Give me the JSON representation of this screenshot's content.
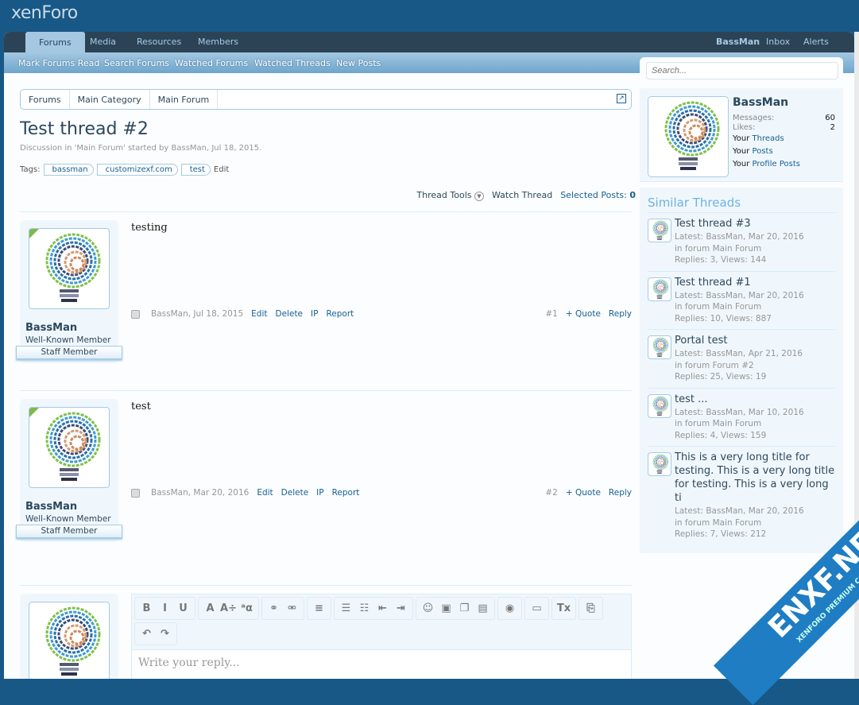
{
  "header": {
    "logo": "xenForo"
  },
  "nav": {
    "tabs": [
      "Forums",
      "Media",
      "Resources",
      "Members"
    ],
    "user": "BassMan",
    "inbox": "Inbox",
    "alerts": "Alerts",
    "subnav": [
      "Mark Forums Read",
      "Search Forums",
      "Watched Forums",
      "Watched Threads",
      "New Posts"
    ]
  },
  "search": {
    "placeholder": "Search..."
  },
  "visitor": {
    "name": "BassMan",
    "messages_label": "Messages:",
    "messages": "60",
    "likes_label": "Likes:",
    "likes": "2",
    "your": "Your",
    "threads": "Threads",
    "posts": "Posts",
    "profile_posts": "Profile Posts"
  },
  "breadcrumb": [
    "Forums",
    "Main Category",
    "Main Forum"
  ],
  "thread": {
    "title": "Test thread #2",
    "description": "Discussion in 'Main Forum' started by BassMan, Jul 18, 2015.",
    "tags_label": "Tags:",
    "tags": [
      "bassman",
      "customizexf.com",
      "test"
    ],
    "tags_edit": "Edit"
  },
  "tools": {
    "thread_tools": "Thread Tools",
    "watch": "Watch Thread",
    "selected_label": "Selected Posts:",
    "selected": "0"
  },
  "posts": [
    {
      "author": "BassMan",
      "title": "Well-Known Member",
      "badge": "Staff Member",
      "message": "testing",
      "date": "BassMan, Jul 18, 2015",
      "edit": "Edit",
      "delete": "Delete",
      "ip": "IP",
      "report": "Report",
      "number": "#1",
      "quote": "+ Quote",
      "reply": "Reply"
    },
    {
      "author": "BassMan",
      "title": "Well-Known Member",
      "badge": "Staff Member",
      "message": "test",
      "date": "BassMan, Mar 20, 2016",
      "edit": "Edit",
      "delete": "Delete",
      "ip": "IP",
      "report": "Report",
      "number": "#2",
      "quote": "+ Quote",
      "reply": "Reply"
    }
  ],
  "editor": {
    "placeholder": "Write your reply...",
    "buttons": [
      "B",
      "I",
      "U",
      "A",
      "A÷",
      "ᵃα",
      "⚭",
      "⚮",
      "≡",
      "☰",
      "☷",
      "⇤",
      "⇥",
      "☺",
      "▣",
      "❐",
      "▤",
      "◉",
      "▭",
      "Tx",
      "⎘",
      "↶",
      "↷"
    ]
  },
  "similar": {
    "title": "Similar Threads",
    "items": [
      {
        "title": "Test thread #3",
        "latest": "Latest: BassMan, Mar 20, 2016",
        "forum": "in forum Main Forum",
        "stats": "Replies: 3, Views: 144"
      },
      {
        "title": "Test thread #1",
        "latest": "Latest: BassMan, Mar 20, 2016",
        "forum": "in forum Main Forum",
        "stats": "Replies: 10, Views: 887"
      },
      {
        "title": "Portal test",
        "latest": "Latest: BassMan, Apr 21, 2016",
        "forum": "in forum Forum #2",
        "stats": "Replies: 25, Views: 19"
      },
      {
        "title": "test ...",
        "latest": "Latest: BassMan, Mar 10, 2016",
        "forum": "in forum Main Forum",
        "stats": "Replies: 4, Views: 159"
      },
      {
        "title": "This is a very long title for testing. This is a very long title for testing. This is a very long ti",
        "latest": "Latest: BassMan, Mar 20, 2016",
        "forum": "in forum Main Forum",
        "stats": "Replies: 7, Views: 212"
      }
    ]
  },
  "watermark": {
    "text": "ENXF.NET",
    "sub": "XENFORO PREMIUM COMMUNITY"
  },
  "colors": {
    "header": "#185886",
    "tabs": "#2c4356",
    "link": "#176093",
    "sidebar": "#f0f7fc"
  }
}
